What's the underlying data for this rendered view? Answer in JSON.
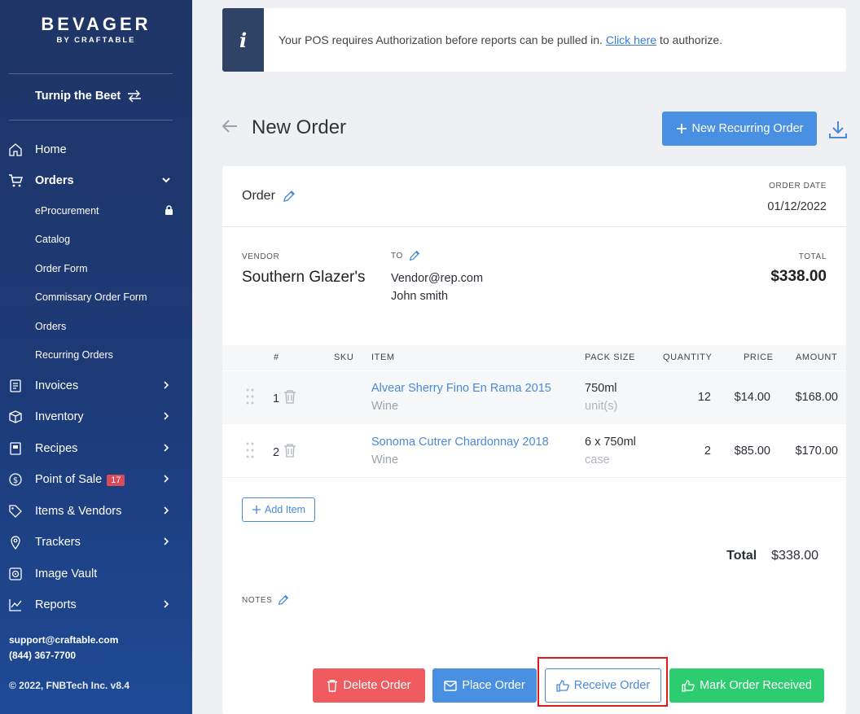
{
  "sidebar": {
    "brand_top": "BEVAGER",
    "brand_bottom": "BY CRAFTABLE",
    "location": "Turnip the Beet",
    "items": [
      {
        "label": "Home"
      },
      {
        "label": "Orders"
      },
      {
        "label": "Invoices"
      },
      {
        "label": "Inventory"
      },
      {
        "label": "Recipes"
      },
      {
        "label": "Point of Sale",
        "badge": "17"
      },
      {
        "label": "Items & Vendors"
      },
      {
        "label": "Trackers"
      },
      {
        "label": "Image Vault"
      },
      {
        "label": "Reports"
      }
    ],
    "sub_items": [
      {
        "label": "eProcurement"
      },
      {
        "label": "Catalog"
      },
      {
        "label": "Order Form"
      },
      {
        "label": "Commissary Order Form"
      },
      {
        "label": "Orders"
      },
      {
        "label": "Recurring Orders"
      }
    ],
    "support_email": "support@craftable.com",
    "support_phone": "(844) 367-7700",
    "copyright": "© 2022, FNBTech Inc. v8.4"
  },
  "alert": {
    "text_before": "Your POS requires Authorization before reports can be pulled in. ",
    "link": "Click here",
    "text_after": " to authorize."
  },
  "header": {
    "title": "New Order",
    "recurring_button": "New Recurring Order"
  },
  "order": {
    "label": "Order",
    "date_label": "ORDER DATE",
    "date": "01/12/2022",
    "vendor_label": "VENDOR",
    "vendor": "Southern Glazer's",
    "to_label": "TO",
    "to_email": "Vendor@rep.com",
    "to_name": "John smith",
    "total_label": "TOTAL",
    "total": "$338.00"
  },
  "table": {
    "headers": {
      "num": "#",
      "sku": "SKU",
      "item": "ITEM",
      "pack": "PACK SIZE",
      "qty": "QUANTITY",
      "price": "PRICE",
      "amount": "AMOUNT"
    },
    "rows": [
      {
        "num": "1",
        "name": "Alvear Sherry Fino En Rama 2015",
        "category": "Wine",
        "pack": "750ml",
        "unit": "unit(s)",
        "qty": "12",
        "price": "$14.00",
        "amount": "$168.00"
      },
      {
        "num": "2",
        "name": "Sonoma Cutrer Chardonnay 2018",
        "category": "Wine",
        "pack": "6 x 750ml",
        "unit": "case",
        "qty": "2",
        "price": "$85.00",
        "amount": "$170.00"
      }
    ]
  },
  "footer": {
    "add_item": "Add Item",
    "total_label": "Total",
    "total_value": "$338.00",
    "notes_label": "NOTES"
  },
  "actions": {
    "delete": "Delete Order",
    "place": "Place Order",
    "receive": "Receive Order",
    "mark": "Mark Order Received"
  },
  "colors": {
    "accent": "#4a90e2",
    "danger": "#ef5b5e",
    "success": "#2ecc71",
    "sidebar": "#1f3566"
  }
}
